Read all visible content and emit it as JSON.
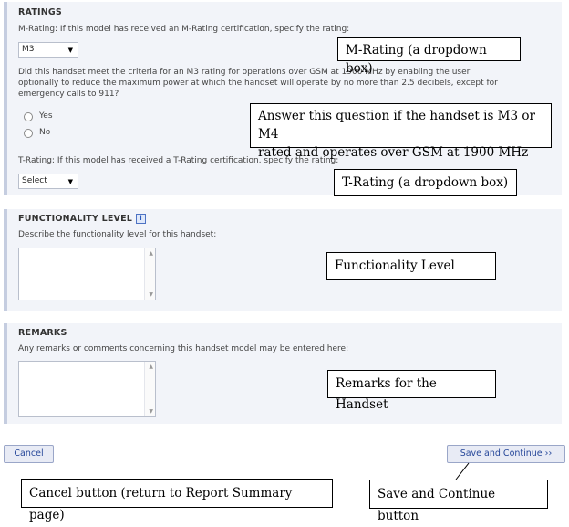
{
  "ratings": {
    "title": "RATINGS",
    "m_rating_prompt": "M-Rating: If this model has received an M-Rating certification, specify the rating:",
    "m_rating_value": "M3",
    "gsm_question_line1": "Did this handset meet the criteria for an M3 rating for operations over GSM at 1900 MHz by enabling the user",
    "gsm_question_line2": "optionally to reduce the maximum power at which the handset will operate by no more than 2.5 decibels, except for",
    "gsm_question_line3": "emergency calls to 911?",
    "yes_label": "Yes",
    "no_label": "No",
    "t_rating_prompt": "T-Rating: If this model has received a T-Rating certification, specify the rating:",
    "t_rating_value": "Select"
  },
  "functionality": {
    "title": "FUNCTIONALITY LEVEL",
    "info_icon": "i",
    "prompt": "Describe the functionality level for this handset:"
  },
  "remarks": {
    "title": "REMARKS",
    "prompt": "Any remarks or comments concerning this handset model may be entered here:"
  },
  "buttons": {
    "cancel": "Cancel",
    "save_continue": "Save and Continue ››"
  },
  "callouts": {
    "m_rating": "M-Rating (a dropdown box)",
    "gsm_line1": "Answer this question if the handset is M3 or M4",
    "gsm_line2": "rated and operates over GSM at 1900 MHz",
    "t_rating": "T-Rating (a dropdown box)",
    "functionality": "Functionality Level",
    "remarks": "Remarks for the Handset",
    "cancel": "Cancel button (return to Report Summary page)",
    "save": "Save and Continue button"
  }
}
